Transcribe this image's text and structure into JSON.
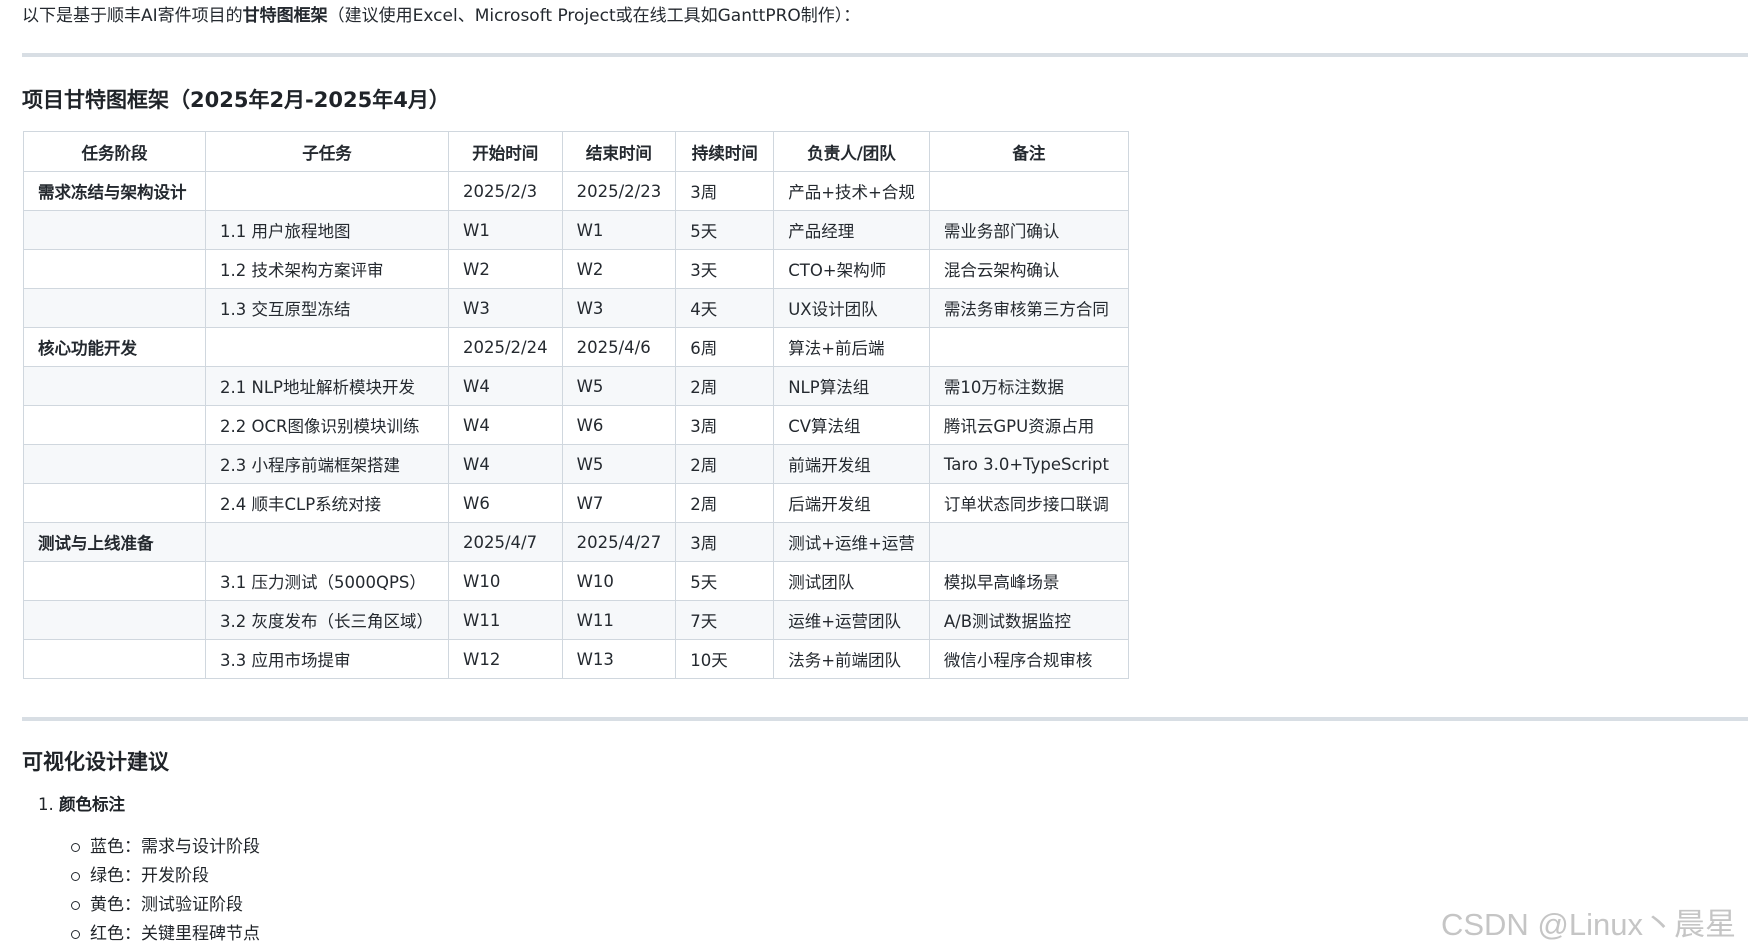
{
  "intro": {
    "prefix": "以下是基于顺丰AI寄件项目的",
    "emphasis": "甘特图框架",
    "suffix": "（建议使用Excel、Microsoft Project或在线工具如GanttPRO制作）："
  },
  "section1": {
    "title": "项目甘特图框架（2025年2月-2025年4月）"
  },
  "table": {
    "headers": [
      "任务阶段",
      "子任务",
      "开始时间",
      "结束时间",
      "持续时间",
      "负责人/团队",
      "备注"
    ],
    "rows": [
      [
        "需求冻结与架构设计",
        "",
        "2025/2/3",
        "2025/2/23",
        "3周",
        "产品+技术+合规",
        ""
      ],
      [
        "",
        "1.1 用户旅程地图",
        "W1",
        "W1",
        "5天",
        "产品经理",
        "需业务部门确认"
      ],
      [
        "",
        "1.2 技术架构方案评审",
        "W2",
        "W2",
        "3天",
        "CTO+架构师",
        "混合云架构确认"
      ],
      [
        "",
        "1.3 交互原型冻结",
        "W3",
        "W3",
        "4天",
        "UX设计团队",
        "需法务审核第三方合同"
      ],
      [
        "核心功能开发",
        "",
        "2025/2/24",
        "2025/4/6",
        "6周",
        "算法+前后端",
        ""
      ],
      [
        "",
        "2.1 NLP地址解析模块开发",
        "W4",
        "W5",
        "2周",
        "NLP算法组",
        "需10万标注数据"
      ],
      [
        "",
        "2.2 OCR图像识别模块训练",
        "W4",
        "W6",
        "3周",
        "CV算法组",
        "腾讯云GPU资源占用"
      ],
      [
        "",
        "2.3 小程序前端框架搭建",
        "W4",
        "W5",
        "2周",
        "前端开发组",
        "Taro 3.0+TypeScript"
      ],
      [
        "",
        "2.4 顺丰CLP系统对接",
        "W6",
        "W7",
        "2周",
        "后端开发组",
        "订单状态同步接口联调"
      ],
      [
        "测试与上线准备",
        "",
        "2025/4/7",
        "2025/4/27",
        "3周",
        "测试+运维+运营",
        ""
      ],
      [
        "",
        "3.1 压力测试（5000QPS）",
        "W10",
        "W10",
        "5天",
        "测试团队",
        "模拟早高峰场景"
      ],
      [
        "",
        "3.2 灰度发布（长三角区域）",
        "W11",
        "W11",
        "7天",
        "运维+运营团队",
        "A/B测试数据监控"
      ],
      [
        "",
        "3.3 应用市场提审",
        "W12",
        "W13",
        "10天",
        "法务+前端团队",
        "微信小程序合规审核"
      ]
    ]
  },
  "section2": {
    "title": "可视化设计建议",
    "ordered_item_number": "1.",
    "ordered_item_label": "颜色标注",
    "color_items": [
      "蓝色：需求与设计阶段",
      "绿色：开发阶段",
      "黄色：测试验证阶段",
      "红色：关键里程碑节点"
    ]
  },
  "watermark": "CSDN @Linux丶晨星"
}
